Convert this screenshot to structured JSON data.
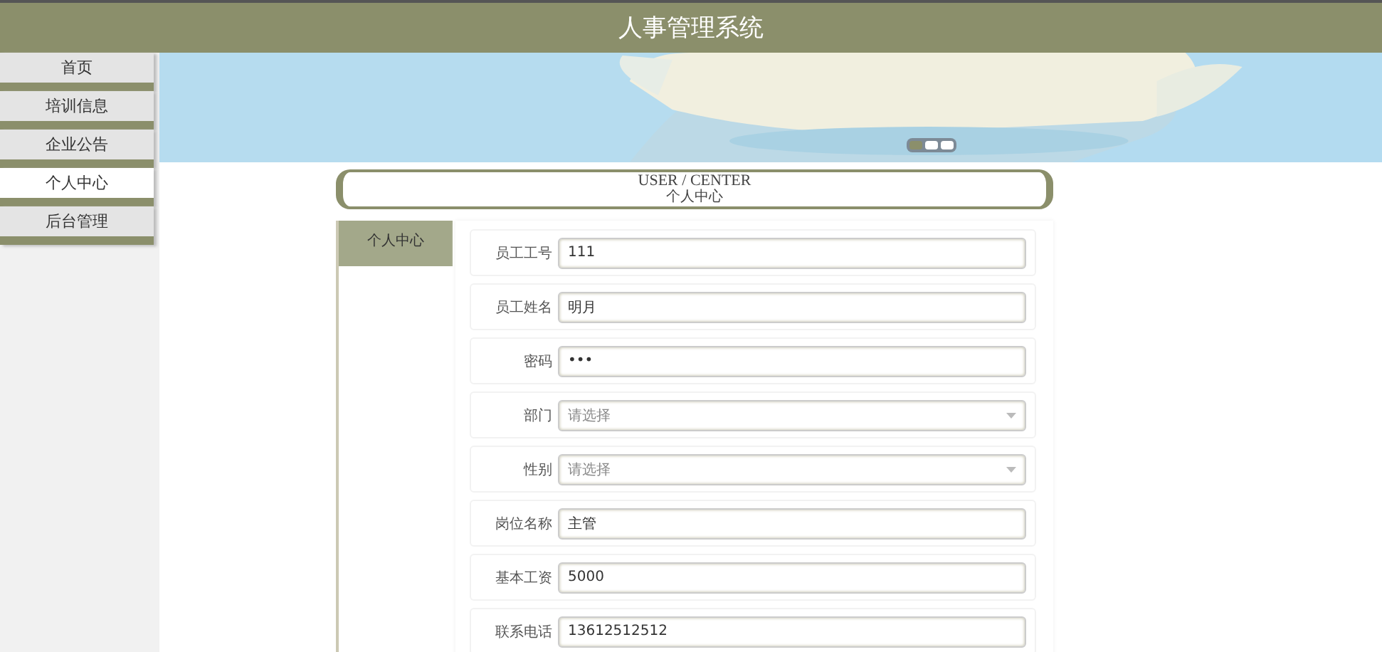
{
  "header": {
    "title": "人事管理系统"
  },
  "sidebar": {
    "items": [
      {
        "label": "首页",
        "selected": false
      },
      {
        "label": "培训信息",
        "selected": false
      },
      {
        "label": "企业公告",
        "selected": false
      },
      {
        "label": "个人中心",
        "selected": true
      },
      {
        "label": "后台管理",
        "selected": false
      }
    ]
  },
  "banner": {
    "kind": "picture",
    "slides": [
      {
        "selected": true
      },
      {
        "selected": false
      },
      {
        "selected": false
      }
    ]
  },
  "section_title": {
    "english": "USER / CENTER",
    "chinese": "个人中心"
  },
  "side_tabs": [
    {
      "label": "个人中心",
      "selected": true
    }
  ],
  "form": {
    "fields": [
      {
        "label": "员工工号",
        "kind": "text",
        "value": "111"
      },
      {
        "label": "员工姓名",
        "kind": "text",
        "value": "明月"
      },
      {
        "label": "密码",
        "kind": "password",
        "value": "•••"
      },
      {
        "label": "部门",
        "kind": "select",
        "placeholder": "请选择"
      },
      {
        "label": "性别",
        "kind": "select",
        "placeholder": "请选择"
      },
      {
        "label": "岗位名称",
        "kind": "text",
        "value": "主管"
      },
      {
        "label": "基本工资",
        "kind": "text",
        "value": "5000"
      },
      {
        "label": "联系电话",
        "kind": "text",
        "value": "13612512512"
      }
    ]
  }
}
